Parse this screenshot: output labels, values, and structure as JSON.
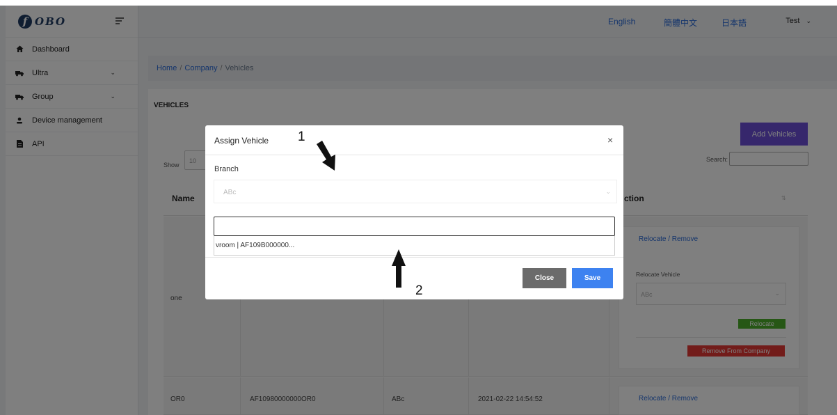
{
  "brand": {
    "logo_text": "OBO",
    "logo_letter": "f"
  },
  "topbar": {
    "languages": [
      "English",
      "簡體中文",
      "日本語"
    ],
    "user_label": "Test"
  },
  "sidebar": {
    "items": [
      {
        "label": "Dashboard",
        "icon": "home-icon"
      },
      {
        "label": "Ultra",
        "icon": "truck-icon",
        "expandable": true
      },
      {
        "label": "Group",
        "icon": "truck-icon",
        "expandable": true
      },
      {
        "label": "Device management",
        "icon": "user-icon"
      },
      {
        "label": "API",
        "icon": "file-icon"
      }
    ]
  },
  "breadcrumb": {
    "home": "Home",
    "company": "Company",
    "current": "Vehicles"
  },
  "card": {
    "title": "VEHICLES",
    "add_button": "Add Vehicles",
    "show_label": "Show",
    "show_value": "10",
    "search_label": "Search:"
  },
  "table": {
    "headers": {
      "name": "Name",
      "action": "ction"
    },
    "rows": [
      {
        "name": "one",
        "action_link": "Relocate / Remove",
        "relocate_label": "Relocate Vehicle",
        "relocate_select": "ABc",
        "relocate_btn": "Relocate",
        "remove_btn": "Remove From Company"
      },
      {
        "name": "OR0",
        "serial": "AF10980000000OR0",
        "branch": "ABc",
        "date": "2021-02-22 14:54:52",
        "action_link": "Relocate / Remove"
      }
    ]
  },
  "modal": {
    "title": "Assign Vehicle",
    "close_glyph": "×",
    "branch_label": "Branch",
    "branch_value": "ABc",
    "vehicle_input_value": "",
    "vehicle_option": "vroom | AF109B000000...",
    "close_button": "Close",
    "save_button": "Save"
  },
  "annotations": {
    "arrow_1_label": "1",
    "arrow_2_label": "2"
  },
  "colors": {
    "link": "#2a6bd8",
    "primary_purple": "#6c4fd8",
    "save_blue": "#3d82f0",
    "close_gray": "#6b6b6b",
    "relocate_green": "#4caf2a",
    "remove_red": "#e53935",
    "brand_navy": "#1f3a63"
  }
}
